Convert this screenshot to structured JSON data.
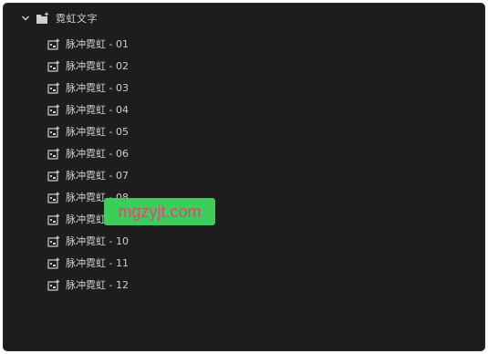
{
  "folder": {
    "label": "霓虹文字",
    "expanded": true,
    "icon": "folder-add-icon"
  },
  "items": [
    {
      "label": "脉冲霓虹 - 01",
      "icon": "template-icon"
    },
    {
      "label": "脉冲霓虹 - 02",
      "icon": "template-icon"
    },
    {
      "label": "脉冲霓虹 - 03",
      "icon": "template-icon"
    },
    {
      "label": "脉冲霓虹 - 04",
      "icon": "template-icon"
    },
    {
      "label": "脉冲霓虹 - 05",
      "icon": "template-icon"
    },
    {
      "label": "脉冲霓虹 - 06",
      "icon": "template-icon"
    },
    {
      "label": "脉冲霓虹 - 07",
      "icon": "template-icon"
    },
    {
      "label": "脉冲霓虹 - 08",
      "icon": "template-icon"
    },
    {
      "label": "脉冲霓虹 - 09",
      "icon": "template-icon"
    },
    {
      "label": "脉冲霓虹 - 10",
      "icon": "template-icon"
    },
    {
      "label": "脉冲霓虹 - 11",
      "icon": "template-icon"
    },
    {
      "label": "脉冲霓虹 - 12",
      "icon": "template-icon"
    }
  ],
  "watermark": {
    "text": "mgzyjt.com"
  },
  "colors": {
    "panel_bg": "#1d1d1d",
    "text": "#cfcfcf",
    "watermark_bg": "#3dcd5a",
    "watermark_text": "#e8427a"
  }
}
